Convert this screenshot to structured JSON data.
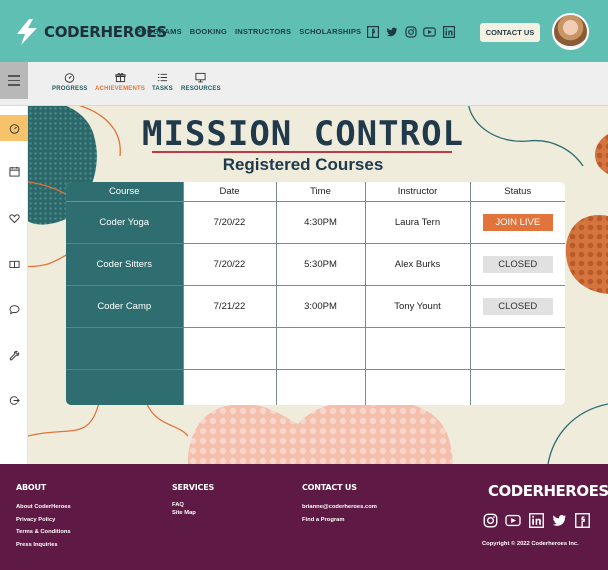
{
  "header": {
    "brand": "CODERHEROES",
    "nav": [
      "PROGRAMS",
      "BOOKING",
      "INSTRUCTORS",
      "SCHOLARSHIPS"
    ],
    "social_icons": [
      "facebook-icon",
      "twitter-icon",
      "instagram-icon",
      "youtube-icon",
      "linkedin-icon"
    ],
    "contact_label": "CONTACT US"
  },
  "subnav": {
    "tabs": [
      {
        "label": "PROGRESS",
        "icon": "gauge-icon",
        "active": false
      },
      {
        "label": "ACHIEVEMENTS",
        "icon": "gift-icon",
        "active": true
      },
      {
        "label": "TASKS",
        "icon": "list-icon",
        "active": false
      },
      {
        "label": "RESOURCES",
        "icon": "monitor-icon",
        "active": false
      }
    ]
  },
  "sidebar": {
    "items": [
      "gauge-icon",
      "calendar-icon",
      "heart-icon",
      "book-icon",
      "chat-icon",
      "wrench-icon",
      "logout-icon"
    ],
    "active_index": 0
  },
  "main": {
    "title": "MISSION CONTROL",
    "subtitle": "Registered Courses",
    "columns": [
      "Course",
      "Date",
      "Time",
      "Instructor",
      "Status"
    ],
    "rows": [
      {
        "course": "Coder Yoga",
        "date": "7/20/22",
        "time": "4:30PM",
        "instructor": "Laura Tern",
        "status": "JOIN LIVE"
      },
      {
        "course": "Coder Sitters",
        "date": "7/20/22",
        "time": "5:30PM",
        "instructor": "Alex Burks",
        "status": "CLOSED"
      },
      {
        "course": "Coder Camp",
        "date": "7/21/22",
        "time": "3:00PM",
        "instructor": "Tony Yount",
        "status": "CLOSED"
      },
      {
        "course": "",
        "date": "",
        "time": "",
        "instructor": "",
        "status": ""
      },
      {
        "course": "",
        "date": "",
        "time": "",
        "instructor": "",
        "status": ""
      }
    ]
  },
  "footer": {
    "about": {
      "heading": "ABOUT",
      "links": [
        "About CoderHeroes",
        "Privacy Policy",
        "Terms & Conditions",
        "Press Inquiries"
      ]
    },
    "services": {
      "heading": "SERVICES",
      "links": [
        "FAQ",
        "Site Map"
      ]
    },
    "contact": {
      "heading": "CONTACT US",
      "links": [
        "brianne@coderheroes.com",
        "Find a Program"
      ]
    },
    "brand": "CODERHEROES",
    "social_icons": [
      "instagram-icon",
      "youtube-icon",
      "linkedin-icon",
      "twitter-icon",
      "facebook-icon"
    ],
    "copyright": "Copyright © 2022 Coderheroes Inc."
  },
  "colors": {
    "header_bg": "#5fbfb2",
    "accent_orange": "#e0743a",
    "table_course_col": "#2f6e70",
    "footer_bg": "#5e1a45",
    "main_bg": "#f0ecdc",
    "title_text": "#203a4c"
  }
}
